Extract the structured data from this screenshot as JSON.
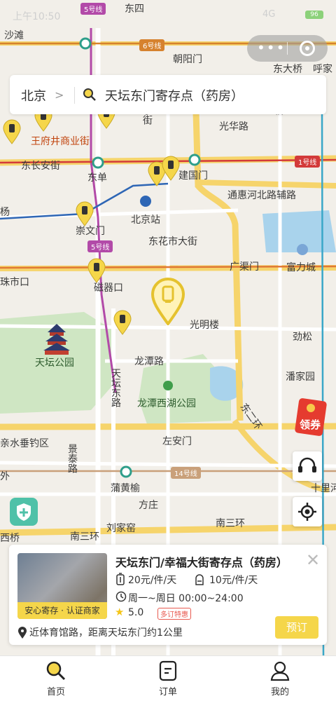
{
  "status_bar": {
    "time": "上午10:50",
    "network": "4G",
    "battery": "96"
  },
  "search": {
    "city": "北京",
    "query": "天坛东门寄存点（药房）"
  },
  "map": {
    "labels": [
      "沙滩",
      "东四",
      "朝阳门",
      "东大桥",
      "呼家",
      "王府井商业街",
      "东长安街",
      "东单",
      "建国门",
      "光华路",
      "北京站",
      "东花市大街",
      "通惠河北路辅路",
      "崇文门",
      "广渠门",
      "富力城",
      "珠市口",
      "磁器口",
      "光明楼",
      "劲松",
      "天坛公园",
      "龙潭路",
      "潘家园",
      "龙潭西湖公园",
      "左安门",
      "亲水垂钓区",
      "景泰路",
      "方庄",
      "蒲黄榆",
      "刘家窑",
      "南三环",
      "南三环",
      "十里河",
      "外",
      "小街",
      "桥",
      "杨",
      "西桥",
      "天坛东路",
      "东二环"
    ],
    "line_badges": [
      "5号线",
      "6号线",
      "1号线",
      "5号线",
      "14号线"
    ]
  },
  "side_buttons": {
    "coupon": "领券"
  },
  "card": {
    "title": "天坛东门/幸福大街寄存点（药房）",
    "badge": "安心寄存 · 认证商家",
    "price_large": "20元/件/天",
    "price_small": "10元/件/天",
    "hours": "周一~周日 00:00~24:00",
    "rating": "5.0",
    "deal": "多订特惠",
    "address": "近体育馆路，距离天坛东门约1公里",
    "book": "预订"
  },
  "tabs": [
    {
      "label": "首页"
    },
    {
      "label": "订单"
    },
    {
      "label": "我的"
    }
  ]
}
